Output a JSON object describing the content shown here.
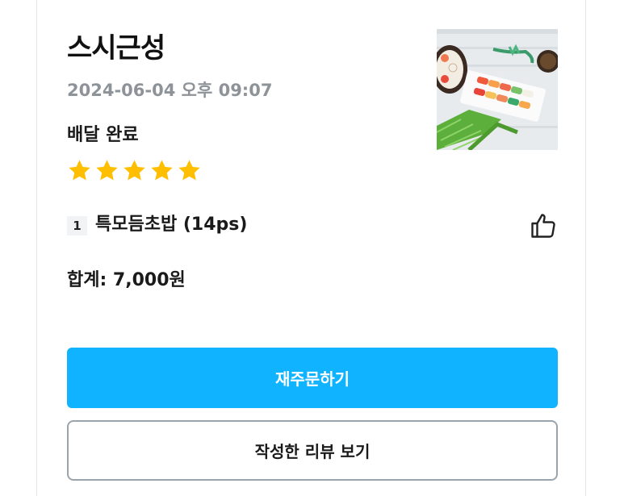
{
  "order": {
    "store_name": "스시근성",
    "date": "2024-06-04 오후 09:07",
    "status": "배달 완료",
    "rating": 5,
    "rating_max": 5,
    "thumbnail_icon": "sushi-platter-photo",
    "items": [
      {
        "quantity": "1",
        "name": "특모듬초밥 (14ps)"
      }
    ],
    "total": "합계: 7,000원"
  },
  "actions": {
    "reorder_label": "재주문하기",
    "review_label": "작성한 리뷰 보기",
    "like_icon": "thumbs-up-icon"
  },
  "colors": {
    "accent": "#10b3ff",
    "star": "#ffbf00",
    "muted_text": "#8d9399"
  }
}
